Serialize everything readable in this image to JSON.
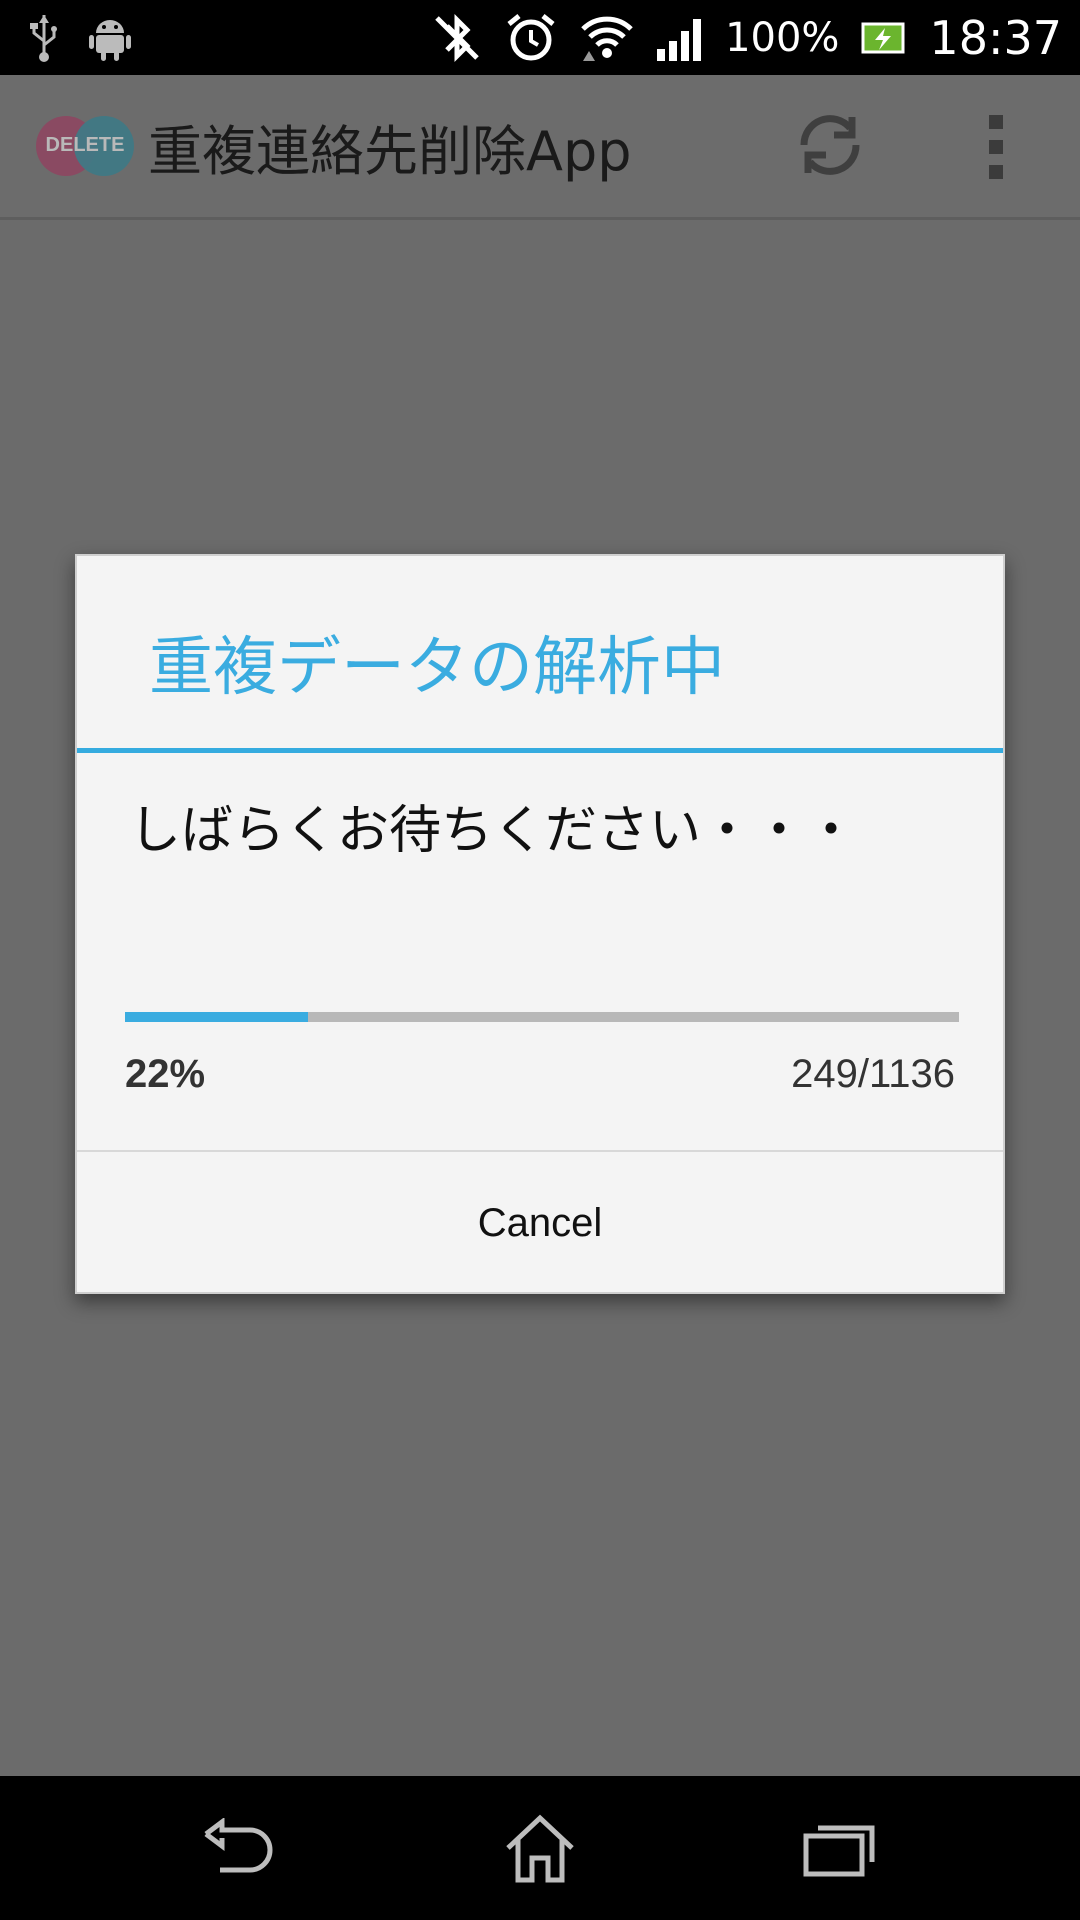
{
  "status_bar": {
    "battery_percent": "100%",
    "clock": "18:37",
    "icons": [
      "usb-icon",
      "android-debug-icon",
      "bluetooth-off-icon",
      "alarm-icon",
      "wifi-icon",
      "signal-icon",
      "battery-charging-icon"
    ]
  },
  "action_bar": {
    "logo_text": "DELETE",
    "title": "重複連絡先削除App",
    "actions": [
      "refresh-icon",
      "overflow-menu-icon"
    ]
  },
  "dialog": {
    "title": "重複データの解析中",
    "message": "しばらくお待ちください・・・",
    "progress": {
      "fraction": 0.22,
      "percent_label": "22%",
      "count_label": "249/1136"
    },
    "cancel_label": "Cancel"
  },
  "nav_bar": {
    "buttons": [
      "back-icon",
      "home-icon",
      "recents-icon"
    ]
  },
  "colors": {
    "accent": "#3aace0",
    "scrim": "#6b6b6b",
    "dialog_bg": "#f4f4f4"
  }
}
